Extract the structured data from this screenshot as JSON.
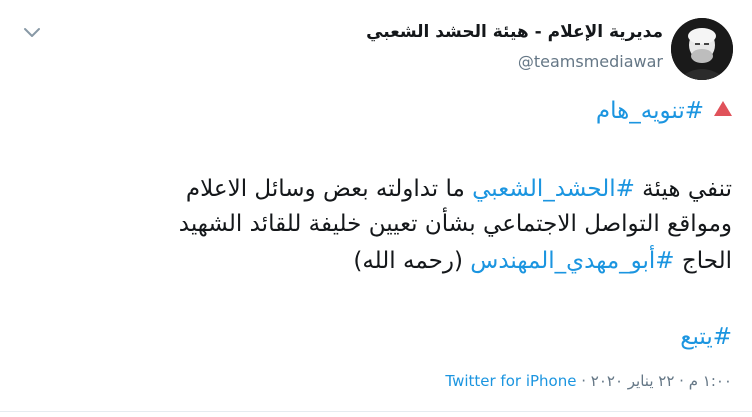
{
  "author": {
    "display_name": "مديرية الإعلام - هيئة الحشد الشعبي",
    "handle": "@teamsmediawar",
    "avatar_icon": "avatar-portrait"
  },
  "tweet": {
    "line1": {
      "icon": "red-triangle-icon",
      "hashtag": "#تنويه_هام"
    },
    "line3": {
      "before": "تنفي هيئة ",
      "hashtag": "#الحشد_الشعبي",
      "after": " ما تداولته بعض وسائل الاعلام"
    },
    "line4": "ومواقع التواصل الاجتماعي بشأن تعيين خليفة للقائد الشهيد",
    "line5": {
      "before": "الحاج ",
      "hashtag": "#أبو_مهدي_المهندس",
      "after": " (رحمه الله)"
    },
    "line6_hashtag": "#يتبع"
  },
  "meta": {
    "time_date": "١:٠٠ م · ٢٢ يناير ٢٠٢٠ · ",
    "source": "Twitter for iPhone"
  },
  "colors": {
    "link": "#1b95e0",
    "text": "#14171a",
    "secondary": "#657786",
    "warning": "#e0525a"
  }
}
